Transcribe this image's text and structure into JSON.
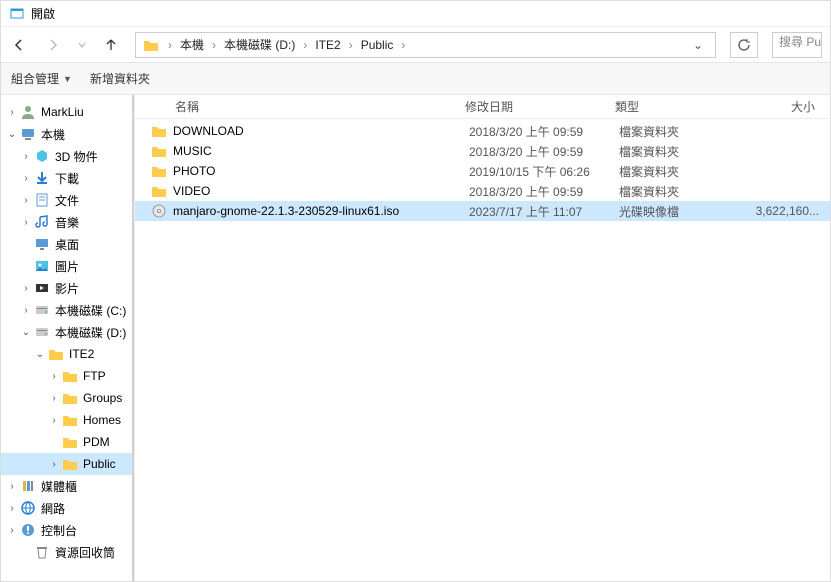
{
  "window_title": "開啟",
  "nav": {
    "back": "←",
    "forward": "→",
    "up": "↑"
  },
  "path": [
    "本機",
    "本機磁碟 (D:)",
    "ITE2",
    "Public"
  ],
  "search_placeholder": "搜尋 Public",
  "toolbar": {
    "organize": "組合管理",
    "new_folder": "新增資料夾"
  },
  "columns": {
    "name": "名稱",
    "date": "修改日期",
    "type": "類型",
    "size": "大小"
  },
  "tree": [
    {
      "icon": "user",
      "label": "MarkLiu",
      "depth": 0,
      "twist": "right"
    },
    {
      "icon": "pc",
      "label": "本機",
      "depth": 0,
      "twist": "down"
    },
    {
      "icon": "3d",
      "label": "3D 物件",
      "depth": 1,
      "twist": "right"
    },
    {
      "icon": "dl",
      "label": "下載",
      "depth": 1,
      "twist": "right"
    },
    {
      "icon": "doc",
      "label": "文件",
      "depth": 1,
      "twist": "right"
    },
    {
      "icon": "music",
      "label": "音樂",
      "depth": 1,
      "twist": "right"
    },
    {
      "icon": "desk",
      "label": "桌面",
      "depth": 1,
      "twist": "none"
    },
    {
      "icon": "pic",
      "label": "圖片",
      "depth": 1,
      "twist": "none"
    },
    {
      "icon": "vid",
      "label": "影片",
      "depth": 1,
      "twist": "right"
    },
    {
      "icon": "disk",
      "label": "本機磁碟 (C:)",
      "depth": 1,
      "twist": "right"
    },
    {
      "icon": "disk",
      "label": "本機磁碟 (D:)",
      "depth": 1,
      "twist": "down"
    },
    {
      "icon": "folder",
      "label": "ITE2",
      "depth": 2,
      "twist": "down"
    },
    {
      "icon": "folder",
      "label": "FTP",
      "depth": 3,
      "twist": "right"
    },
    {
      "icon": "folder",
      "label": "Groups",
      "depth": 3,
      "twist": "right"
    },
    {
      "icon": "folder",
      "label": "Homes",
      "depth": 3,
      "twist": "right"
    },
    {
      "icon": "folder",
      "label": "PDM",
      "depth": 3,
      "twist": "none"
    },
    {
      "icon": "folder",
      "label": "Public",
      "depth": 3,
      "twist": "right",
      "selected": true
    },
    {
      "icon": "lib",
      "label": "媒體櫃",
      "depth": 0,
      "twist": "right"
    },
    {
      "icon": "net",
      "label": "網路",
      "depth": 0,
      "twist": "right"
    },
    {
      "icon": "ctrl",
      "label": "控制台",
      "depth": 0,
      "twist": "right"
    },
    {
      "icon": "bin",
      "label": "資源回收筒",
      "depth": 1,
      "twist": "none"
    }
  ],
  "files": [
    {
      "icon": "folder",
      "name": "DOWNLOAD",
      "date": "2018/3/20 上午 09:59",
      "type": "檔案資料夾",
      "size": ""
    },
    {
      "icon": "folder",
      "name": "MUSIC",
      "date": "2018/3/20 上午 09:59",
      "type": "檔案資料夾",
      "size": ""
    },
    {
      "icon": "folder",
      "name": "PHOTO",
      "date": "2019/10/15 下午 06:26",
      "type": "檔案資料夾",
      "size": ""
    },
    {
      "icon": "folder",
      "name": "VIDEO",
      "date": "2018/3/20 上午 09:59",
      "type": "檔案資料夾",
      "size": ""
    },
    {
      "icon": "iso",
      "name": "manjaro-gnome-22.1.3-230529-linux61.iso",
      "date": "2023/7/17 上午 11:07",
      "type": "光碟映像檔",
      "size": "3,622,160...",
      "selected": true
    }
  ]
}
